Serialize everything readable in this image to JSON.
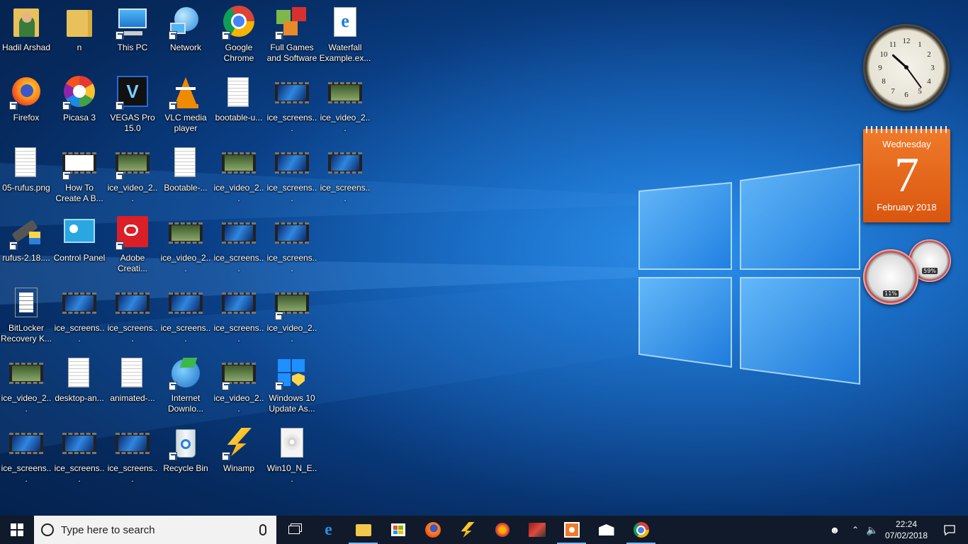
{
  "desktop": {
    "icons": [
      {
        "label": "Hadil Arshad",
        "icon": "user-folder-icon"
      },
      {
        "label": "Firefox",
        "icon": "firefox-icon"
      },
      {
        "label": "05-rufus.png",
        "icon": "image-file-icon"
      },
      {
        "label": "rufus-2.18....",
        "icon": "usb-drive-icon"
      },
      {
        "label": "BitLocker Recovery K...",
        "icon": "text-file-icon"
      },
      {
        "label": "ice_video_2...",
        "icon": "video-file-icon"
      },
      {
        "label": "ice_screens...",
        "icon": "screenshot-file-icon"
      },
      {
        "label": "n",
        "icon": "folder-icon"
      },
      {
        "label": "Picasa 3",
        "icon": "picasa-icon"
      },
      {
        "label": "How To Create A B...",
        "icon": "video-shortcut-icon"
      },
      {
        "label": "Control Panel",
        "icon": "control-panel-icon"
      },
      {
        "label": "ice_screens...",
        "icon": "screenshot-file-icon"
      },
      {
        "label": "desktop-an...",
        "icon": "image-file-icon"
      },
      {
        "label": "ice_screens...",
        "icon": "screenshot-file-icon"
      },
      {
        "label": "This PC",
        "icon": "computer-icon"
      },
      {
        "label": "VEGAS Pro 15.0",
        "icon": "vegas-icon"
      },
      {
        "label": "ice_video_2...",
        "icon": "video-file-icon"
      },
      {
        "label": "Adobe Creati...",
        "icon": "adobe-cc-icon"
      },
      {
        "label": "ice_screens...",
        "icon": "screenshot-file-icon"
      },
      {
        "label": "animated-...",
        "icon": "image-file-icon"
      },
      {
        "label": "ice_screens...",
        "icon": "screenshot-file-icon"
      },
      {
        "label": "Network",
        "icon": "network-icon"
      },
      {
        "label": "VLC media player",
        "icon": "vlc-icon"
      },
      {
        "label": "Bootable-...",
        "icon": "image-file-icon"
      },
      {
        "label": "ice_video_2...",
        "icon": "video-file-icon"
      },
      {
        "label": "ice_screens...",
        "icon": "screenshot-file-icon"
      },
      {
        "label": "Internet Downlo...",
        "icon": "idm-icon"
      },
      {
        "label": "Recycle Bin",
        "icon": "recycle-bin-icon"
      },
      {
        "label": "Google Chrome",
        "icon": "chrome-icon"
      },
      {
        "label": "bootable-u...",
        "icon": "image-file-icon"
      },
      {
        "label": "ice_video_2...",
        "icon": "video-file-icon"
      },
      {
        "label": "ice_screens...",
        "icon": "screenshot-file-icon"
      },
      {
        "label": "ice_screens...",
        "icon": "screenshot-file-icon"
      },
      {
        "label": "ice_video_2...",
        "icon": "video-file-icon"
      },
      {
        "label": "Winamp",
        "icon": "winamp-icon"
      },
      {
        "label": "Full Games and Software",
        "icon": "games-cubes-icon"
      },
      {
        "label": "ice_screens...",
        "icon": "screenshot-file-icon"
      },
      {
        "label": "ice_screens...",
        "icon": "screenshot-file-icon"
      },
      {
        "label": "ice_screens...",
        "icon": "screenshot-file-icon"
      },
      {
        "label": "ice_video_2...",
        "icon": "video-file-icon"
      },
      {
        "label": "Windows 10 Update As...",
        "icon": "windows-update-icon"
      },
      {
        "label": "Win10_N_E...",
        "icon": "disc-image-icon"
      },
      {
        "label": "Waterfall Example.ex...",
        "icon": "edge-file-icon"
      },
      {
        "label": "ice_video_2...",
        "icon": "video-file-icon"
      },
      {
        "label": "ice_screens...",
        "icon": "screenshot-file-icon"
      }
    ]
  },
  "gadgets": {
    "clock": {
      "hour": 10,
      "minute": 24
    },
    "calendar": {
      "weekday": "Wednesday",
      "day": "7",
      "month_year": "February 2018"
    },
    "cpu_meter": {
      "cpu_percent": "11%",
      "memory_percent": "59%",
      "cpu_value": 11,
      "memory_value": 59
    }
  },
  "taskbar": {
    "search_placeholder": "Type here to search",
    "apps": [
      {
        "name": "task-view-icon",
        "active": false
      },
      {
        "name": "edge-icon",
        "active": false
      },
      {
        "name": "file-explorer-icon",
        "active": true
      },
      {
        "name": "store-icon",
        "active": false
      },
      {
        "name": "firefox-icon",
        "active": false
      },
      {
        "name": "winamp-icon",
        "active": false
      },
      {
        "name": "firefox-alt-icon",
        "active": false
      },
      {
        "name": "game-icon",
        "active": false
      },
      {
        "name": "screenshot-app-icon",
        "active": true
      },
      {
        "name": "mail-icon",
        "active": false
      },
      {
        "name": "chrome-icon",
        "active": true
      }
    ],
    "time": "22:24",
    "date": "07/02/2018"
  },
  "colors": {
    "accent": "#0a63c9",
    "taskbar": "#101a2a",
    "calendar": "#e8651e"
  }
}
